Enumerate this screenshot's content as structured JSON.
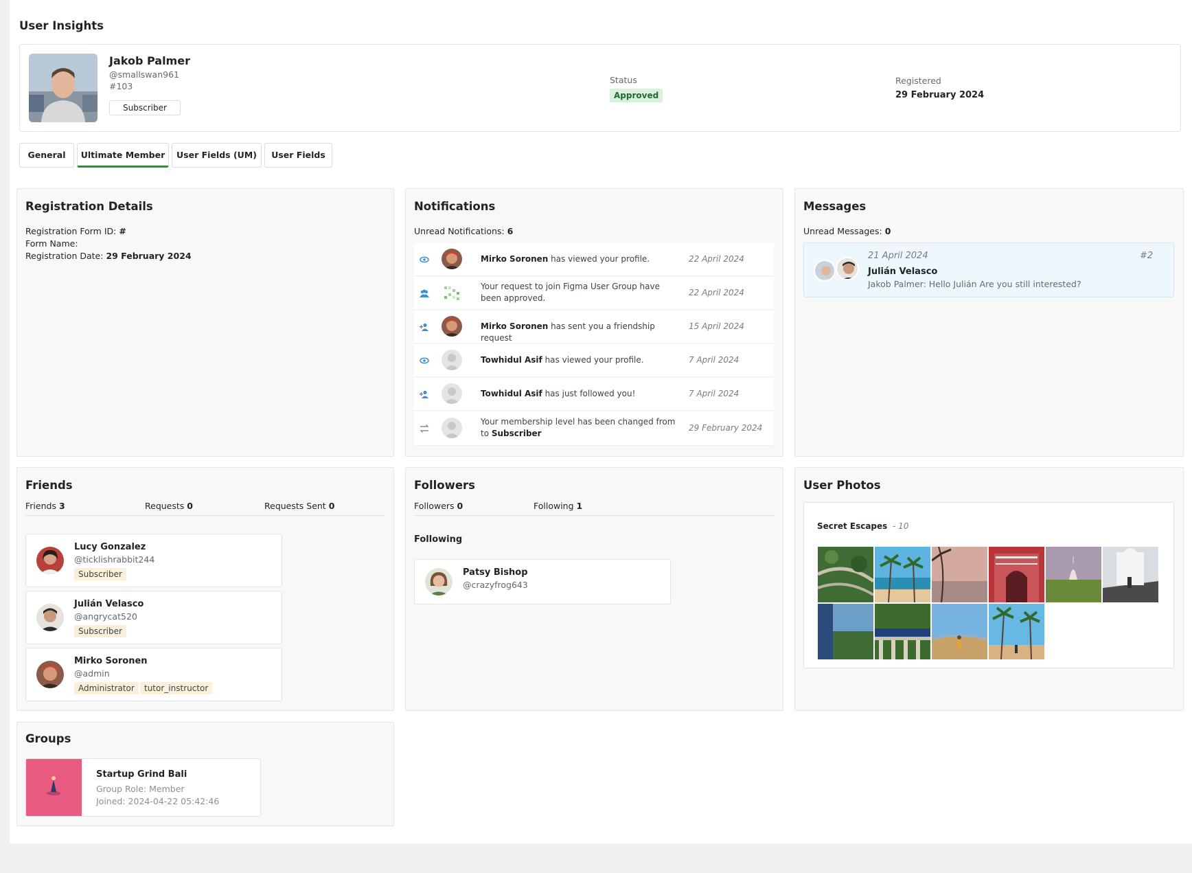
{
  "page": {
    "title": "User Insights"
  },
  "user": {
    "name": "Jakob Palmer",
    "handle": "@smallswan961",
    "id": "#103",
    "role": "Subscriber",
    "status_label": "Status",
    "status_value": "Approved",
    "registered_label": "Registered",
    "registered_value": "29 February 2024"
  },
  "tabs": [
    {
      "label": "General"
    },
    {
      "label": "Ultimate Member"
    },
    {
      "label": "User Fields (UM)"
    },
    {
      "label": "User Fields"
    }
  ],
  "registration": {
    "title": "Registration Details",
    "form_id_label": "Registration Form ID:",
    "form_id_value": "#",
    "form_name_label": "Form Name:",
    "date_label": "Registration Date:",
    "date_value": "29 February 2024"
  },
  "notifications": {
    "title": "Notifications",
    "unread_label": "Unread Notifications:",
    "unread_count": "6",
    "items": [
      {
        "icon": "eye-icon",
        "bold": "Mirko Soronen",
        "text": " has viewed your profile.",
        "date": "22 April 2024"
      },
      {
        "icon": "group-icon",
        "bold": "",
        "text": "Your request to join Figma User Group have been approved.",
        "date": "22 April 2024"
      },
      {
        "icon": "user-add-icon",
        "bold": "Mirko Soronen",
        "text": " has sent you a friendship request",
        "date": "15 April 2024"
      },
      {
        "icon": "eye-icon",
        "bold": "Towhidul Asif",
        "text": " has viewed your profile.",
        "date": "7 April 2024"
      },
      {
        "icon": "user-add-icon",
        "bold": "Towhidul Asif",
        "text": " has just followed you!",
        "date": "7 April 2024"
      },
      {
        "icon": "swap-icon",
        "bold": "",
        "text": "Your membership level has been changed from to ",
        "bold_after": "Subscriber",
        "date": "29 February 2024"
      }
    ]
  },
  "messages": {
    "title": "Messages",
    "unread_label": "Unread Messages:",
    "unread_count": "0",
    "thread": {
      "date": "21 April 2024",
      "number": "#2",
      "name": "Julián Velasco",
      "preview": "Jakob Palmer: Hello Julián Are you still interested?"
    }
  },
  "friends": {
    "title": "Friends",
    "friends_label": "Friends",
    "friends_count": "3",
    "requests_label": "Requests",
    "requests_count": "0",
    "sent_label": "Requests Sent",
    "sent_count": "0",
    "items": [
      {
        "name": "Lucy Gonzalez",
        "handle": "@ticklishrabbit244",
        "roles": [
          "Subscriber"
        ]
      },
      {
        "name": "Julián Velasco",
        "handle": "@angrycat520",
        "roles": [
          "Subscriber"
        ]
      },
      {
        "name": "Mirko Soronen",
        "handle": "@admin",
        "roles": [
          "Administrator",
          "tutor_instructor"
        ]
      }
    ]
  },
  "followers": {
    "title": "Followers",
    "followers_label": "Followers",
    "followers_count": "0",
    "following_label": "Following",
    "following_count": "1",
    "section_title": "Following",
    "items": [
      {
        "name": "Patsy Bishop",
        "handle": "@crazyfrog643"
      }
    ]
  },
  "photos": {
    "title": "User Photos",
    "album_name": "Secret Escapes",
    "album_count": "10"
  },
  "groups": {
    "title": "Groups",
    "items": [
      {
        "name": "Startup Grind Bali",
        "role": "Group Role: Member",
        "joined": "Joined: 2024-04-22 05:42:46"
      }
    ]
  }
}
